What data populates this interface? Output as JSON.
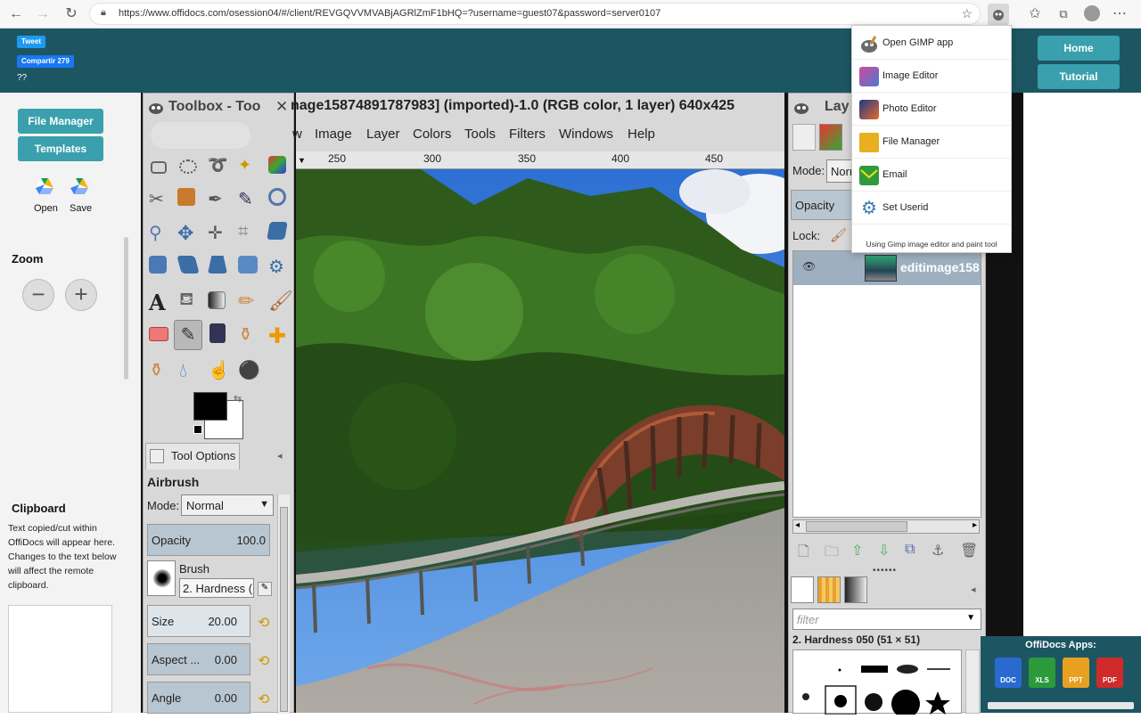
{
  "browser": {
    "url": "https://www.offidocs.com/osession04/#/client/REVGQVVMVABjAGRlZmF1bHQ=?username=guest07&password=server0107"
  },
  "header": {
    "tweet_label": "Tweet",
    "share_label": "Compartir 279",
    "qmarks": "??",
    "home_label": "Home",
    "tutorial_label": "Tutorial"
  },
  "sidebar": {
    "file_manager_label": "File Manager",
    "templates_label": "Templates",
    "open_label": "Open",
    "save_label": "Save",
    "zoom_label": "Zoom",
    "zoom_out": "−",
    "zoom_in": "+",
    "clipboard_title": "Clipboard",
    "clipboard_text": "Text copied/cut within OffiDocs will appear here. Changes to the text below will affect the remote clipboard."
  },
  "toolbox": {
    "title": "Toolbox - Too",
    "tool_options_tab": "Tool Options",
    "tool_name": "Airbrush",
    "mode_label": "Mode:",
    "mode_value": "Normal",
    "opacity_label": "Opacity",
    "opacity_value": "100.0",
    "brush_label": "Brush",
    "brush_value": "2. Hardness (",
    "size_label": "Size",
    "size_value": "20.00",
    "aspect_label": "Aspect ...",
    "aspect_value": "0.00",
    "angle_label": "Angle",
    "angle_value": "0.00"
  },
  "image_window": {
    "title": "nage15874891787983] (imported)-1.0 (RGB color, 1 layer) 640x425",
    "menu": [
      "w",
      "Image",
      "Layer",
      "Colors",
      "Tools",
      "Filters",
      "Windows",
      "Help"
    ],
    "ruler_ticks": [
      "250",
      "300",
      "350",
      "400",
      "450"
    ]
  },
  "layers": {
    "title": "Lay",
    "mode_label": "Mode:",
    "mode_value": "Norr",
    "opacity_label": "Opacity",
    "lock_label": "Lock:",
    "layer_name": "editimage158",
    "filter_placeholder": "filter",
    "brush_name": "2. Hardness 050 (51 × 51)"
  },
  "popup": {
    "items": [
      {
        "label": "Open GIMP app",
        "icon": "gimp-icon"
      },
      {
        "label": "Image Editor",
        "icon": "image-editor-icon"
      },
      {
        "label": "Photo Editor",
        "icon": "photo-editor-icon"
      },
      {
        "label": "File Manager",
        "icon": "folder-icon"
      },
      {
        "label": "Email",
        "icon": "email-icon"
      },
      {
        "label": "Set Userid",
        "icon": "gear-icon"
      }
    ],
    "footer": "Using Gimp image editor and paint tool"
  },
  "offidocs_apps": {
    "title": "OffiDocs Apps:",
    "apps": [
      "DOC",
      "XLS",
      "PPT",
      "PDF"
    ]
  },
  "colors": {
    "teal": "#1d5663",
    "button": "#3aa0ad"
  }
}
